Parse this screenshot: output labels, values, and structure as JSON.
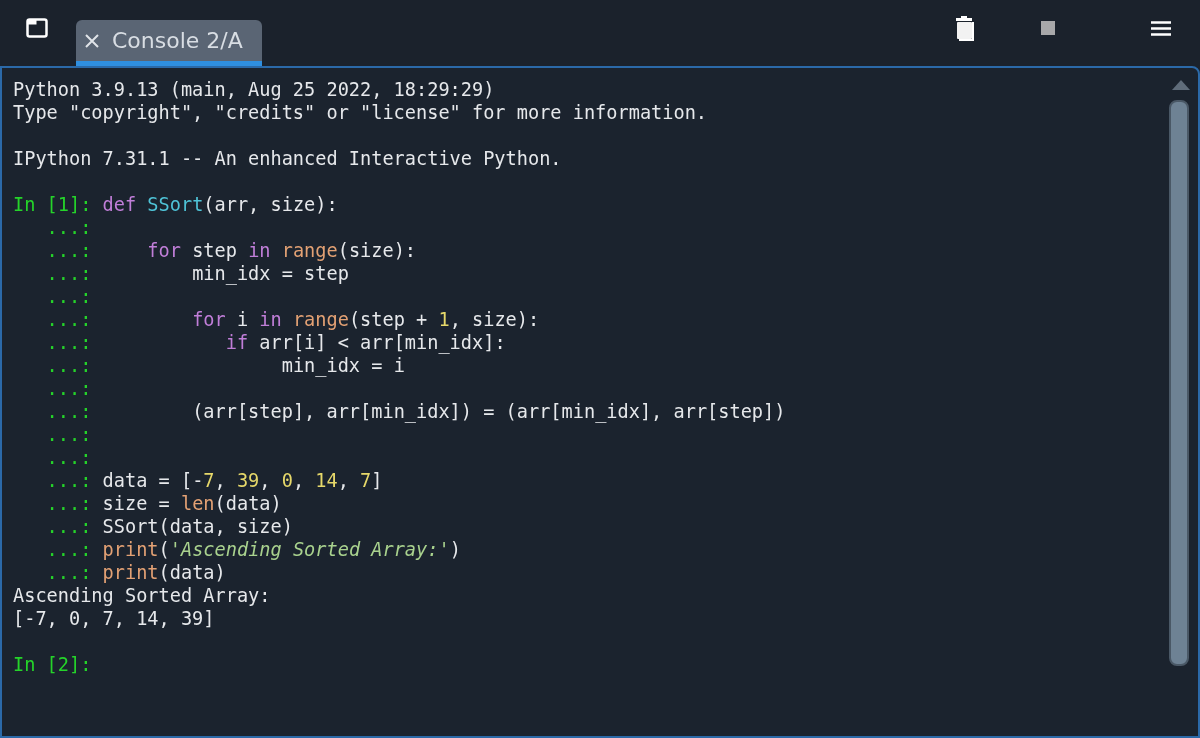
{
  "tabs": [
    {
      "label": "Console 2/A",
      "selected": true
    }
  ],
  "console": {
    "lines": [
      {
        "kind": "output",
        "text": "Python 3.9.13 (main, Aug 25 2022, 18:29:29)"
      },
      {
        "kind": "output",
        "text": "Type \"copyright\", \"credits\" or \"license\" for more information."
      },
      {
        "kind": "blank"
      },
      {
        "kind": "output",
        "text": "IPython 7.31.1 -- An enhanced Interactive Python."
      },
      {
        "kind": "blank"
      },
      {
        "kind": "input",
        "prompt": "In [1]:",
        "tokens": [
          {
            "kind": "keyword",
            "text": "def"
          },
          {
            "kind": "funcname",
            "text": " SSort"
          },
          {
            "kind": "plain",
            "text": "(arr, size):"
          }
        ]
      },
      {
        "kind": "input",
        "prompt": "   ...:"
      },
      {
        "kind": "input",
        "prompt": "   ...:",
        "tokens": [
          {
            "kind": "keyword",
            "text": "    for"
          },
          {
            "kind": "plain",
            "text": " step "
          },
          {
            "kind": "keyword",
            "text": "in"
          },
          {
            "kind": "builtin",
            "text": " range"
          },
          {
            "kind": "plain",
            "text": "(size):"
          }
        ]
      },
      {
        "kind": "input",
        "prompt": "   ...:",
        "tokens": [
          {
            "kind": "plain",
            "text": "        min_idx = step"
          }
        ]
      },
      {
        "kind": "input",
        "prompt": "   ...:"
      },
      {
        "kind": "input",
        "prompt": "   ...:",
        "tokens": [
          {
            "kind": "keyword",
            "text": "        for"
          },
          {
            "kind": "plain",
            "text": " i "
          },
          {
            "kind": "keyword",
            "text": "in"
          },
          {
            "kind": "builtin",
            "text": " range"
          },
          {
            "kind": "plain",
            "text": "(step + "
          },
          {
            "kind": "number",
            "text": "1"
          },
          {
            "kind": "plain",
            "text": ", size):"
          }
        ]
      },
      {
        "kind": "input",
        "prompt": "   ...:",
        "tokens": [
          {
            "kind": "keyword",
            "text": "           if"
          },
          {
            "kind": "plain",
            "text": " arr[i] < arr[min_idx]:"
          }
        ]
      },
      {
        "kind": "input",
        "prompt": "   ...:",
        "tokens": [
          {
            "kind": "plain",
            "text": "                min_idx = i"
          }
        ]
      },
      {
        "kind": "input",
        "prompt": "   ...:"
      },
      {
        "kind": "input",
        "prompt": "   ...:",
        "tokens": [
          {
            "kind": "plain",
            "text": "        (arr[step], arr[min_idx]) = (arr[min_idx], arr[step])"
          }
        ]
      },
      {
        "kind": "input",
        "prompt": "   ...:"
      },
      {
        "kind": "input",
        "prompt": "   ...:"
      },
      {
        "kind": "input",
        "prompt": "   ...:",
        "tokens": [
          {
            "kind": "plain",
            "text": "data = [-"
          },
          {
            "kind": "number",
            "text": "7"
          },
          {
            "kind": "plain",
            "text": ", "
          },
          {
            "kind": "number",
            "text": "39"
          },
          {
            "kind": "plain",
            "text": ", "
          },
          {
            "kind": "number",
            "text": "0"
          },
          {
            "kind": "plain",
            "text": ", "
          },
          {
            "kind": "number",
            "text": "14"
          },
          {
            "kind": "plain",
            "text": ", "
          },
          {
            "kind": "number",
            "text": "7"
          },
          {
            "kind": "plain",
            "text": "]"
          }
        ]
      },
      {
        "kind": "input",
        "prompt": "   ...:",
        "tokens": [
          {
            "kind": "plain",
            "text": "size = "
          },
          {
            "kind": "builtin",
            "text": "len"
          },
          {
            "kind": "plain",
            "text": "(data)"
          }
        ]
      },
      {
        "kind": "input",
        "prompt": "   ...:",
        "tokens": [
          {
            "kind": "plain",
            "text": "SSort(data, size)"
          }
        ]
      },
      {
        "kind": "input",
        "prompt": "   ...:",
        "tokens": [
          {
            "kind": "builtin",
            "text": "print"
          },
          {
            "kind": "plain",
            "text": "("
          },
          {
            "kind": "string",
            "text": "'Ascending Sorted Array:'"
          },
          {
            "kind": "plain",
            "text": ")"
          }
        ]
      },
      {
        "kind": "input",
        "prompt": "   ...:",
        "tokens": [
          {
            "kind": "builtin",
            "text": "print"
          },
          {
            "kind": "plain",
            "text": "(data)"
          }
        ]
      },
      {
        "kind": "output",
        "text": "Ascending Sorted Array:"
      },
      {
        "kind": "output",
        "text": "[-7, 0, 7, 14, 39]"
      },
      {
        "kind": "blank"
      },
      {
        "kind": "input",
        "prompt": "In [2]:"
      }
    ]
  }
}
